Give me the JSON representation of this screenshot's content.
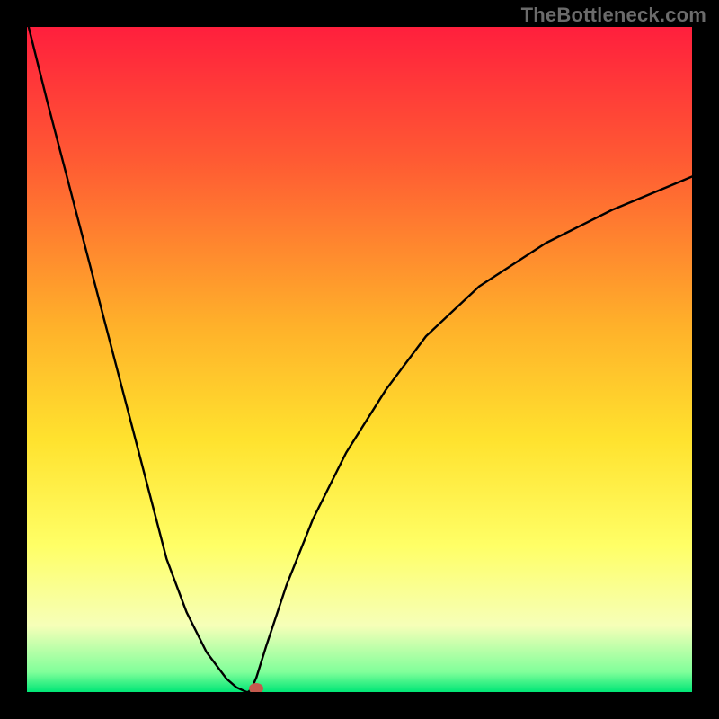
{
  "watermark": "TheBottleneck.com",
  "chart_data": {
    "type": "line",
    "title": "",
    "xlabel": "",
    "ylabel": "",
    "xlim": [
      0,
      100
    ],
    "ylim": [
      0,
      100
    ],
    "gradient_stops": [
      {
        "pct": 0,
        "color": "#ff1f3d"
      },
      {
        "pct": 20,
        "color": "#ff5a33"
      },
      {
        "pct": 45,
        "color": "#ffb12a"
      },
      {
        "pct": 62,
        "color": "#ffe22e"
      },
      {
        "pct": 78,
        "color": "#ffff66"
      },
      {
        "pct": 90,
        "color": "#f6ffb8"
      },
      {
        "pct": 97,
        "color": "#80ff9a"
      },
      {
        "pct": 100,
        "color": "#00e676"
      }
    ],
    "curve": {
      "x": [
        0,
        3,
        6,
        9,
        12,
        15,
        18,
        21,
        24,
        27,
        30,
        31.5,
        33,
        33.3,
        33.8,
        34.5,
        36,
        39,
        43,
        48,
        54,
        60,
        68,
        78,
        88,
        100
      ],
      "y": [
        101,
        89,
        77.5,
        66,
        54.5,
        43,
        31.5,
        20,
        12,
        6,
        2,
        0.7,
        0,
        0,
        0.6,
        2.2,
        7,
        16,
        26,
        36,
        45.5,
        53.5,
        61,
        67.5,
        72.5,
        77.5
      ]
    },
    "marker": {
      "x": 34.5,
      "y": 0.5
    }
  }
}
